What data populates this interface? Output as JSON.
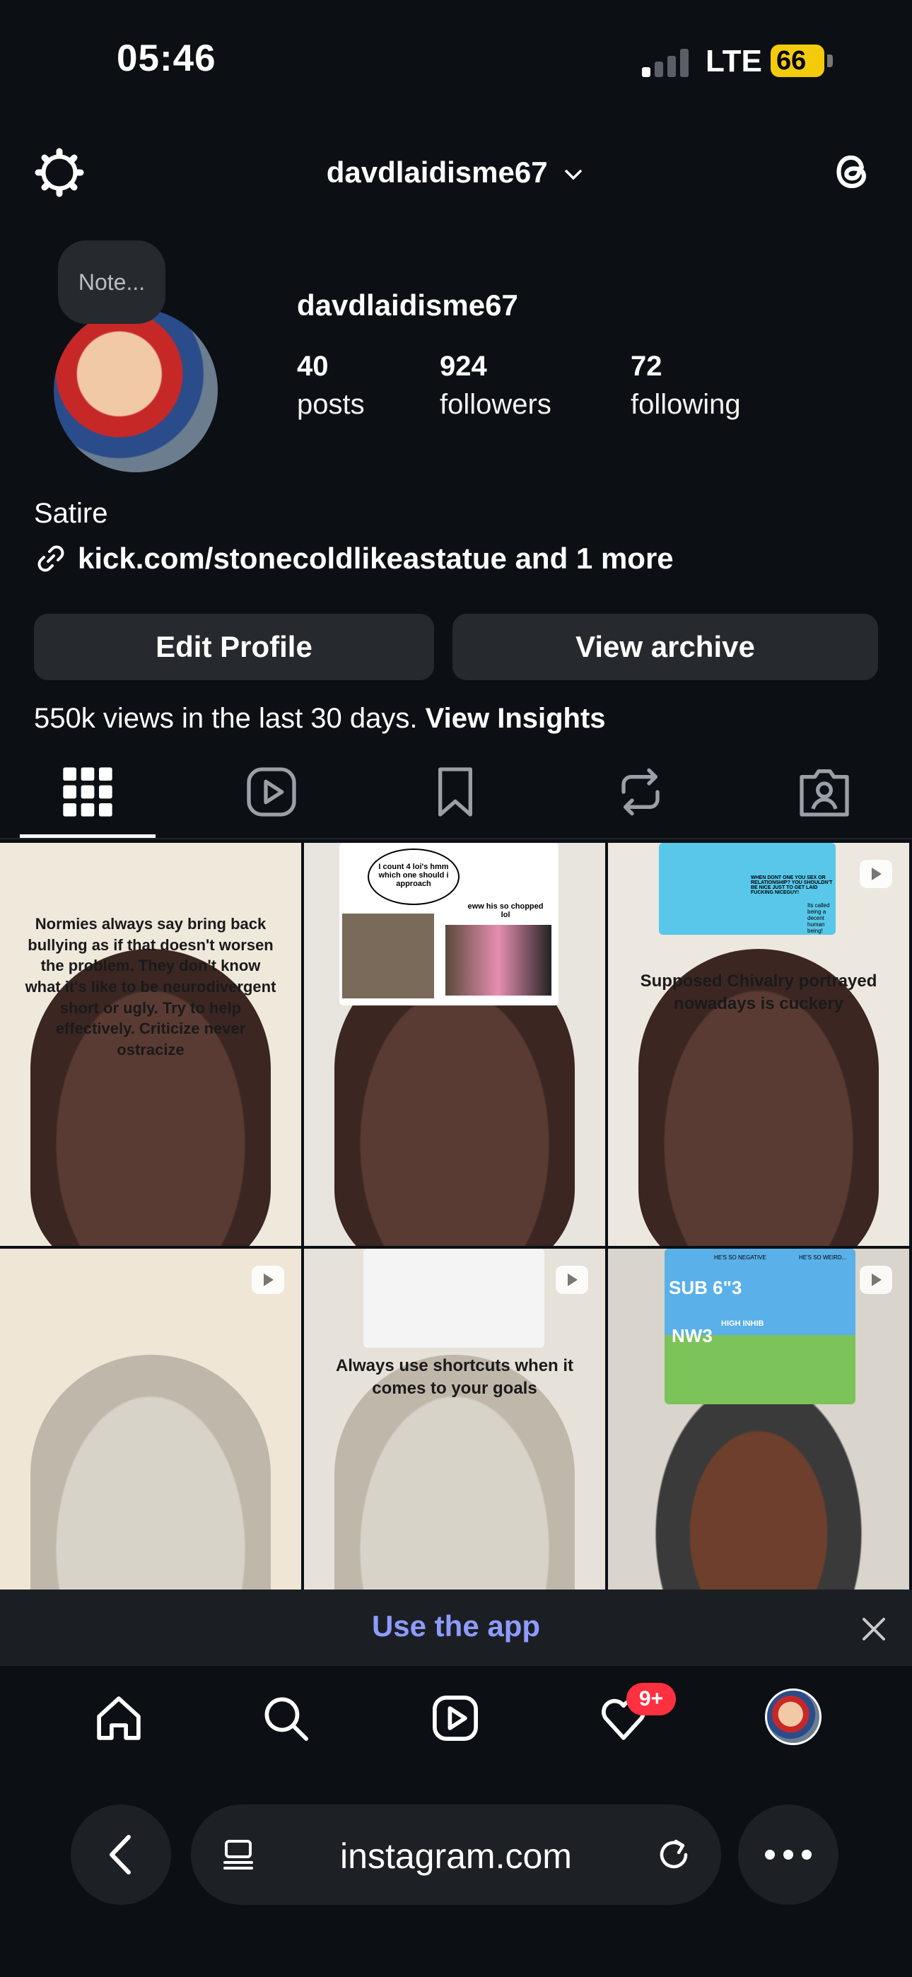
{
  "status_bar": {
    "time": "05:46",
    "network": "LTE",
    "battery": "66"
  },
  "header": {
    "username": "davdlaidisme67"
  },
  "profile": {
    "note": "Note...",
    "name": "davdlaidisme67",
    "stats": [
      {
        "value": "40",
        "label": "posts"
      },
      {
        "value": "924",
        "label": "followers"
      },
      {
        "value": "72",
        "label": "following"
      }
    ],
    "bio": "Satire",
    "link": "kick.com/stonecoldlikeastatue and 1 more",
    "edit_button": "Edit Profile",
    "archive_button": "View archive",
    "insights_text": "550k views in the last 30 days.",
    "insights_link": "View Insights"
  },
  "posts": [
    {
      "caption": "Normies always say bring back bullying as if that doesn't worsen the problem. They don't know what it's like to be neurodivergent short or ugly. Try to help effectively. Criticize never ostracize"
    },
    {
      "bubble": "I count 4 loi's hmm which one should i approach",
      "meme_text": "eww his so chopped lol"
    },
    {
      "caption": "Supposed Chivalry portrayed nowadays is cuckery",
      "meme_text": "WHEN DONT ONE YOU SEX OR RELATIONSHIP? YOU SHOULDN'T BE NICE JUST TO GET LAID FUCKING NICEGUY!",
      "meme_reply": "Its called being a decent human being!"
    },
    {
      "caption": ""
    },
    {
      "caption": "Always use shortcuts when it comes to your goals"
    },
    {
      "meme_labels": [
        "SUB 6\"3",
        "NW3",
        "HIGH INHIB",
        "HE'S SO NEGATIVE",
        "HE'S SO WEIRD..."
      ]
    }
  ],
  "use_app": {
    "label": "Use the app"
  },
  "nav": {
    "notification_badge": "9+"
  },
  "browser": {
    "url": "instagram.com"
  }
}
